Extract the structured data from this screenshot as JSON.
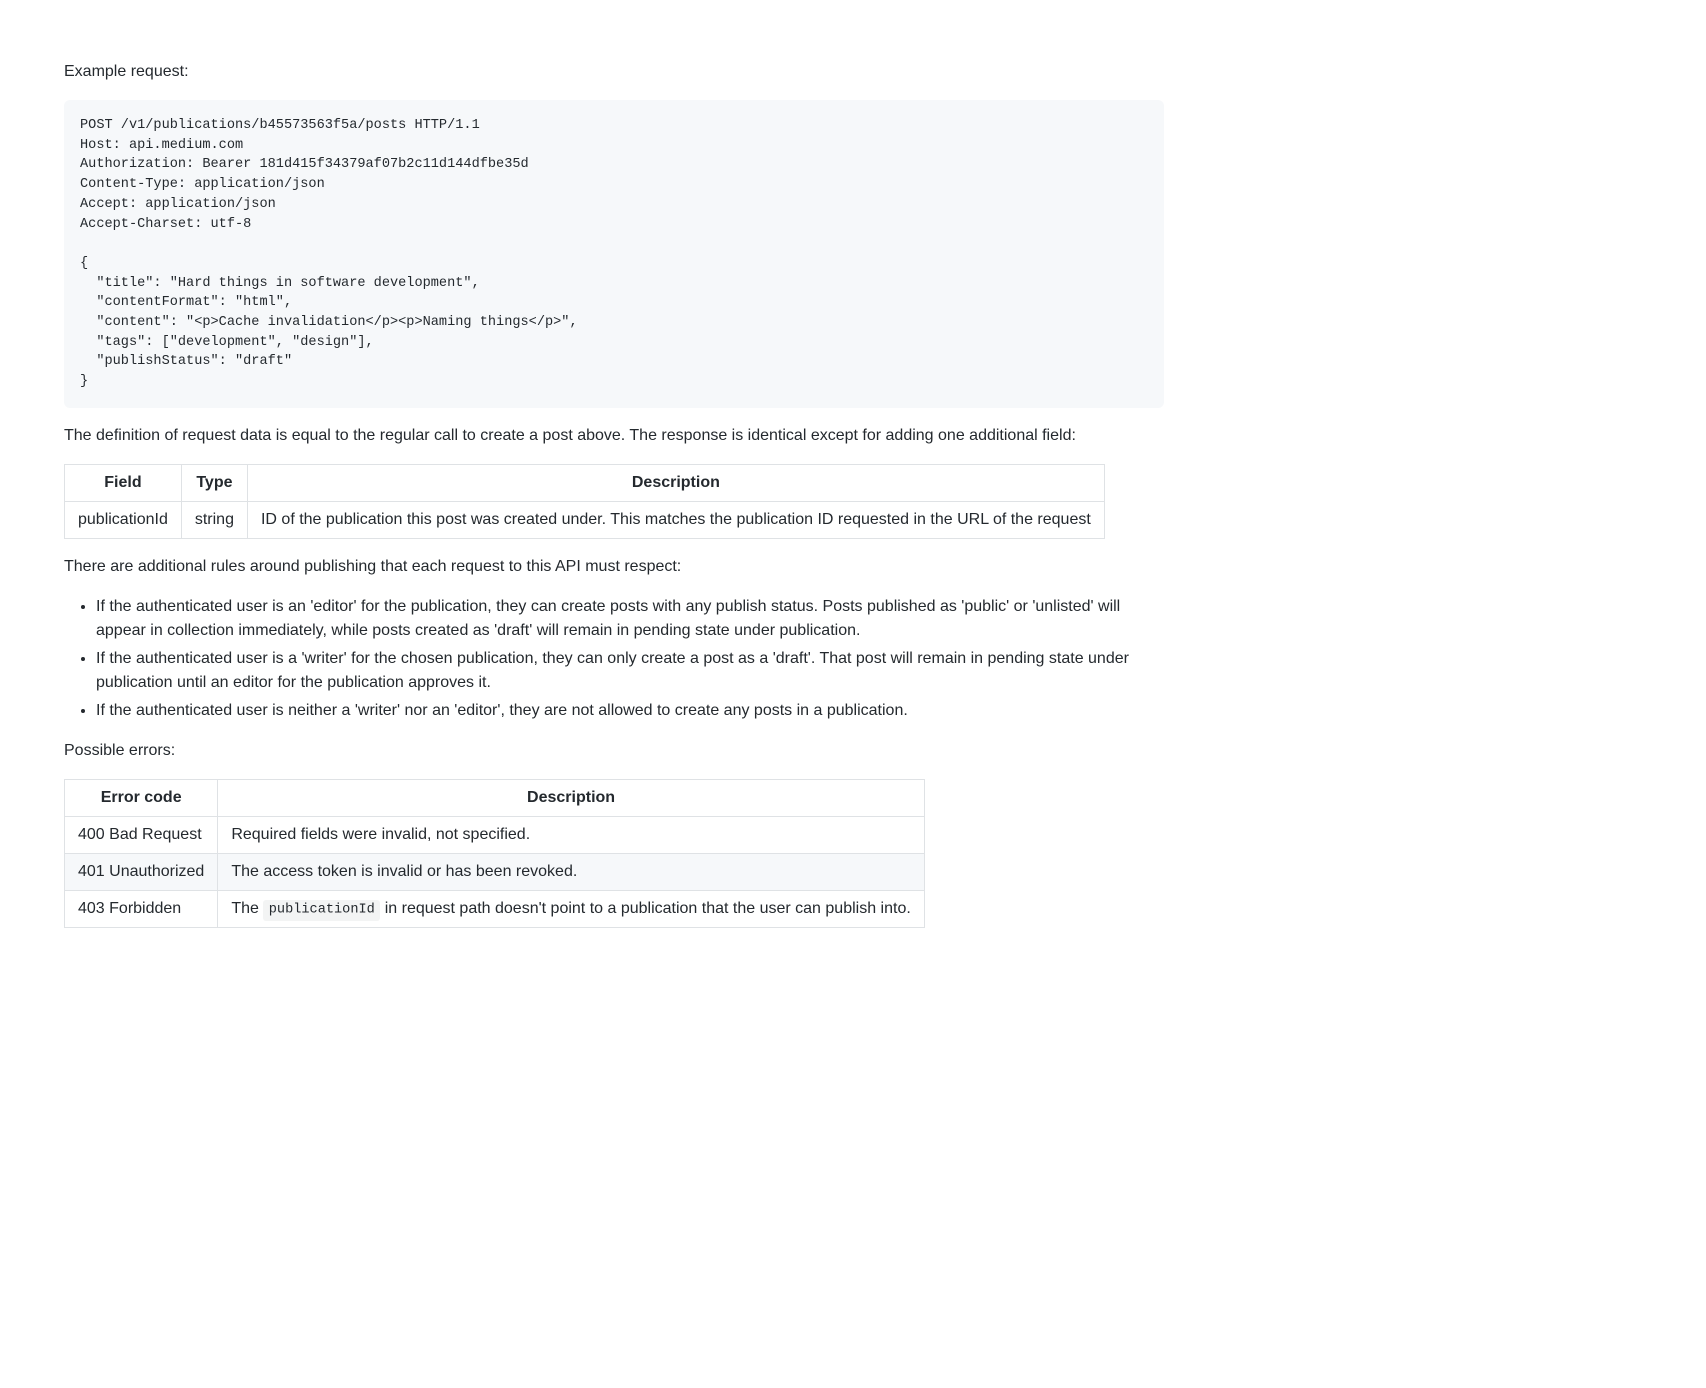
{
  "intro": {
    "example_label": "Example request:",
    "code_block": "POST /v1/publications/b45573563f5a/posts HTTP/1.1\nHost: api.medium.com\nAuthorization: Bearer 181d415f34379af07b2c11d144dfbe35d\nContent-Type: application/json\nAccept: application/json\nAccept-Charset: utf-8\n\n{\n  \"title\": \"Hard things in software development\",\n  \"contentFormat\": \"html\",\n  \"content\": \"<p>Cache invalidation</p><p>Naming things</p>\",\n  \"tags\": [\"development\", \"design\"],\n  \"publishStatus\": \"draft\"\n}"
  },
  "definition_paragraph": "The definition of request data is equal to the regular call to create a post above. The response is identical except for adding one additional field:",
  "fields_table": {
    "headers": {
      "field": "Field",
      "type": "Type",
      "description": "Description"
    },
    "row": {
      "field": "publicationId",
      "type": "string",
      "description": "ID of the publication this post was created under. This matches the publication ID requested in the URL of the request"
    }
  },
  "rules_intro": "There are additional rules around publishing that each request to this API must respect:",
  "rules": {
    "item1": "If the authenticated user is an 'editor' for the publication, they can create posts with any publish status. Posts published as 'public' or 'unlisted' will appear in collection immediately, while posts created as 'draft' will remain in pending state under publication.",
    "item2": "If the authenticated user is a 'writer' for the chosen publication, they can only create a post as a 'draft'. That post will remain in pending state under publication until an editor for the publication approves it.",
    "item3": "If the authenticated user is neither a 'writer' nor an 'editor', they are not allowed to create any posts in a publication."
  },
  "errors_label": "Possible errors:",
  "errors_table": {
    "headers": {
      "code": "Error code",
      "description": "Description"
    },
    "rows": {
      "r1": {
        "code": "400 Bad Request",
        "description": "Required fields were invalid, not specified."
      },
      "r2": {
        "code": "401 Unauthorized",
        "description": "The access token is invalid or has been revoked."
      },
      "r3": {
        "code": "403 Forbidden",
        "prefix": "The ",
        "inline_code": "publicationId",
        "suffix": " in request path doesn't point to a publication that the user can publish into."
      }
    }
  }
}
